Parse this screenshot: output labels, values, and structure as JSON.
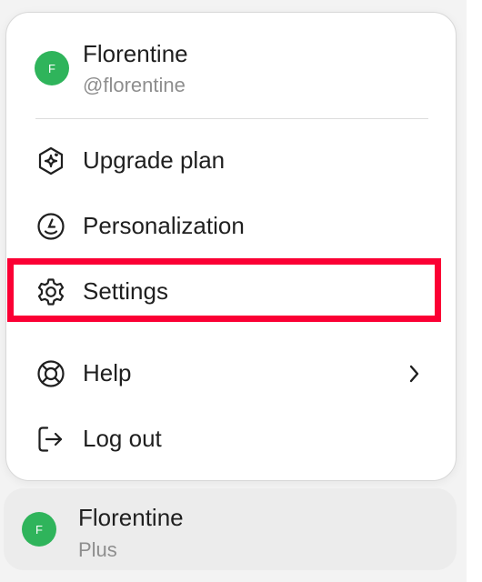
{
  "menu": {
    "user": {
      "avatar_letter": "F",
      "name": "Florentine",
      "handle": "@florentine",
      "avatar_color": "#2fb45b"
    },
    "items": [
      {
        "id": "upgrade",
        "label": "Upgrade plan",
        "icon": "upgrade-plan-icon"
      },
      {
        "id": "personalization",
        "label": "Personalization",
        "icon": "personalization-icon"
      },
      {
        "id": "settings",
        "label": "Settings",
        "icon": "gear-icon"
      },
      {
        "id": "help",
        "label": "Help",
        "icon": "lifebuoy-icon",
        "has_submenu": true
      },
      {
        "id": "logout",
        "label": "Log out",
        "icon": "logout-icon"
      }
    ]
  },
  "account": {
    "avatar_letter": "F",
    "name": "Florentine",
    "plan": "Plus"
  },
  "highlight_color": "#fb0034"
}
